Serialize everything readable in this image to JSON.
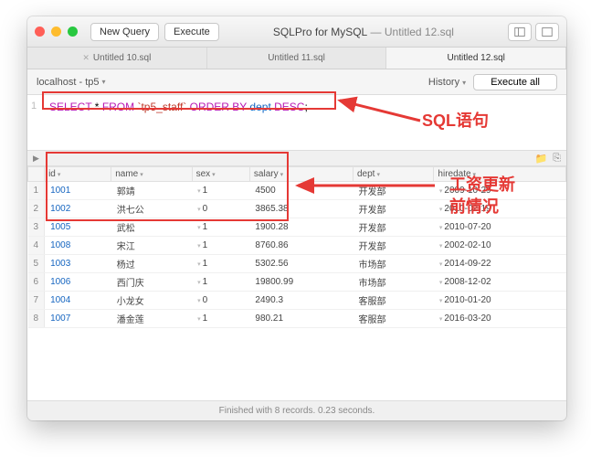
{
  "titlebar": {
    "new_query": "New Query",
    "execute": "Execute",
    "app": "SQLPro for MySQL",
    "doc": "Untitled 12.sql"
  },
  "tabs": [
    "Untitled 10.sql",
    "Untitled 11.sql",
    "Untitled 12.sql"
  ],
  "active_tab": 2,
  "toolbar2": {
    "connection": "localhost - tp5",
    "history": "History",
    "execute_all": "Execute all"
  },
  "editor": {
    "line": "1",
    "sql_parts": {
      "select": "SELECT",
      "star": " * ",
      "from": "FROM",
      "table": " `tp5_staff` ",
      "orderby": "ORDER BY",
      "col": " dept ",
      "desc": "DESC",
      "semi": ";"
    }
  },
  "columns": [
    "",
    "id",
    "name",
    "sex",
    "salary",
    "dept",
    "hiredate"
  ],
  "rows": [
    {
      "n": "1",
      "id": "1001",
      "name": "郭靖",
      "sex": "1",
      "salary": "4500",
      "dept": "开发部",
      "hiredate": "2009-10-29"
    },
    {
      "n": "2",
      "id": "1002",
      "name": "洪七公",
      "sex": "0",
      "salary": "3865.38",
      "dept": "开发部",
      "hiredate": "2010-02-19"
    },
    {
      "n": "3",
      "id": "1005",
      "name": "武松",
      "sex": "1",
      "salary": "1900.28",
      "dept": "开发部",
      "hiredate": "2010-07-20"
    },
    {
      "n": "4",
      "id": "1008",
      "name": "宋江",
      "sex": "1",
      "salary": "8760.86",
      "dept": "开发部",
      "hiredate": "2002-02-10"
    },
    {
      "n": "5",
      "id": "1003",
      "name": "杨过",
      "sex": "1",
      "salary": "5302.56",
      "dept": "市场部",
      "hiredate": "2014-09-22"
    },
    {
      "n": "6",
      "id": "1006",
      "name": "西门庆",
      "sex": "1",
      "salary": "19800.99",
      "dept": "市场部",
      "hiredate": "2008-12-02"
    },
    {
      "n": "7",
      "id": "1004",
      "name": "小龙女",
      "sex": "0",
      "salary": "2490.3",
      "dept": "客服部",
      "hiredate": "2010-01-20"
    },
    {
      "n": "8",
      "id": "1007",
      "name": "潘金莲",
      "sex": "1",
      "salary": "980.21",
      "dept": "客服部",
      "hiredate": "2016-03-20"
    }
  ],
  "status": "Finished with 8 records. 0.23 seconds.",
  "annotations": {
    "sql": "SQL语句",
    "update1": "工资更新",
    "update2": "前情况"
  }
}
